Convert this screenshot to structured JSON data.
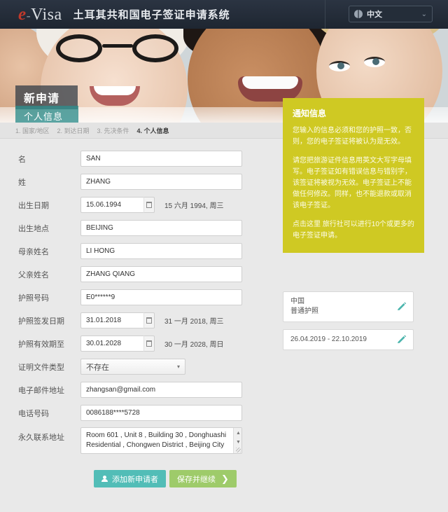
{
  "header": {
    "logo_e": "e",
    "logo_dash": "-",
    "logo_text": "Visa",
    "site_title": "土耳其共和国电子签证申请系统",
    "language": "中文",
    "chevron": "⌄"
  },
  "hero": {
    "title": "新申请",
    "subtitle": "个人信息"
  },
  "breadcrumb": [
    {
      "label": "1. 国家/地区",
      "active": false
    },
    {
      "label": "2. 到达日期",
      "active": false
    },
    {
      "label": "3. 先决条件",
      "active": false
    },
    {
      "label": "4. 个人信息",
      "active": true
    }
  ],
  "form": {
    "given_name": {
      "label": "名",
      "value": "SAN"
    },
    "surname": {
      "label": "姓",
      "value": "ZHANG"
    },
    "birth_date": {
      "label": "出生日期",
      "value": "15.06.1994",
      "hint": "15 六月 1994, 周三"
    },
    "birth_place": {
      "label": "出生地点",
      "value": "BEIJING"
    },
    "mother_name": {
      "label": "母亲姓名",
      "value": "LI HONG"
    },
    "father_name": {
      "label": "父亲姓名",
      "value": "ZHANG QIANG"
    },
    "passport_no": {
      "label": "护照号码",
      "value": "E0******9"
    },
    "passport_issue": {
      "label": "护照签发日期",
      "value": "31.01.2018",
      "hint": "31 一月 2018, 周三"
    },
    "passport_expiry": {
      "label": "护照有效期至",
      "value": "30.01.2028",
      "hint": "30 一月 2028, 周日"
    },
    "doc_type": {
      "label": "证明文件类型",
      "value": "不存在",
      "caret": "▾"
    },
    "email": {
      "label": "电子邮件地址",
      "value": "zhangsan@gmail.com"
    },
    "phone": {
      "label": "电话号码",
      "value": "0086188****5728"
    },
    "address": {
      "label": "永久联系地址",
      "value": "Room 601 , Unit 8 , Building 30 , Donghuashi Residential , Chongwen District , Beijing City"
    }
  },
  "notice": {
    "title": "通知信息",
    "paragraph1": "您输入的信息必须和您的护照一致，否则，您的电子签证将被认为是无效。",
    "paragraph2": "请您把旅游证件信息用英文大写字母填写。电子签证如有错误信息与错别字，该签证将被视为无效。电子签证上不能做任何修改。同样，也不能退款或取消该电子签证。",
    "paragraph3": "点击这里 旅行社可以进行10个或更多的电子签证申请。"
  },
  "cards": [
    {
      "line1": "中国",
      "line2": "普通护照",
      "edit_icon": "pencil-icon"
    },
    {
      "line1": "26.04.2019 - 22.10.2019",
      "line2": "",
      "edit_icon": "pencil-icon"
    }
  ],
  "buttons": {
    "add_applicant": "添加新申请者",
    "save_continue": "保存并继续",
    "arrow": "❯"
  },
  "colors": {
    "header_bg": "#1e2631",
    "notice_bg": "#cfc923",
    "teal": "#52bdb7",
    "green": "#9ecb6a",
    "logo_red": "#c0392b"
  }
}
